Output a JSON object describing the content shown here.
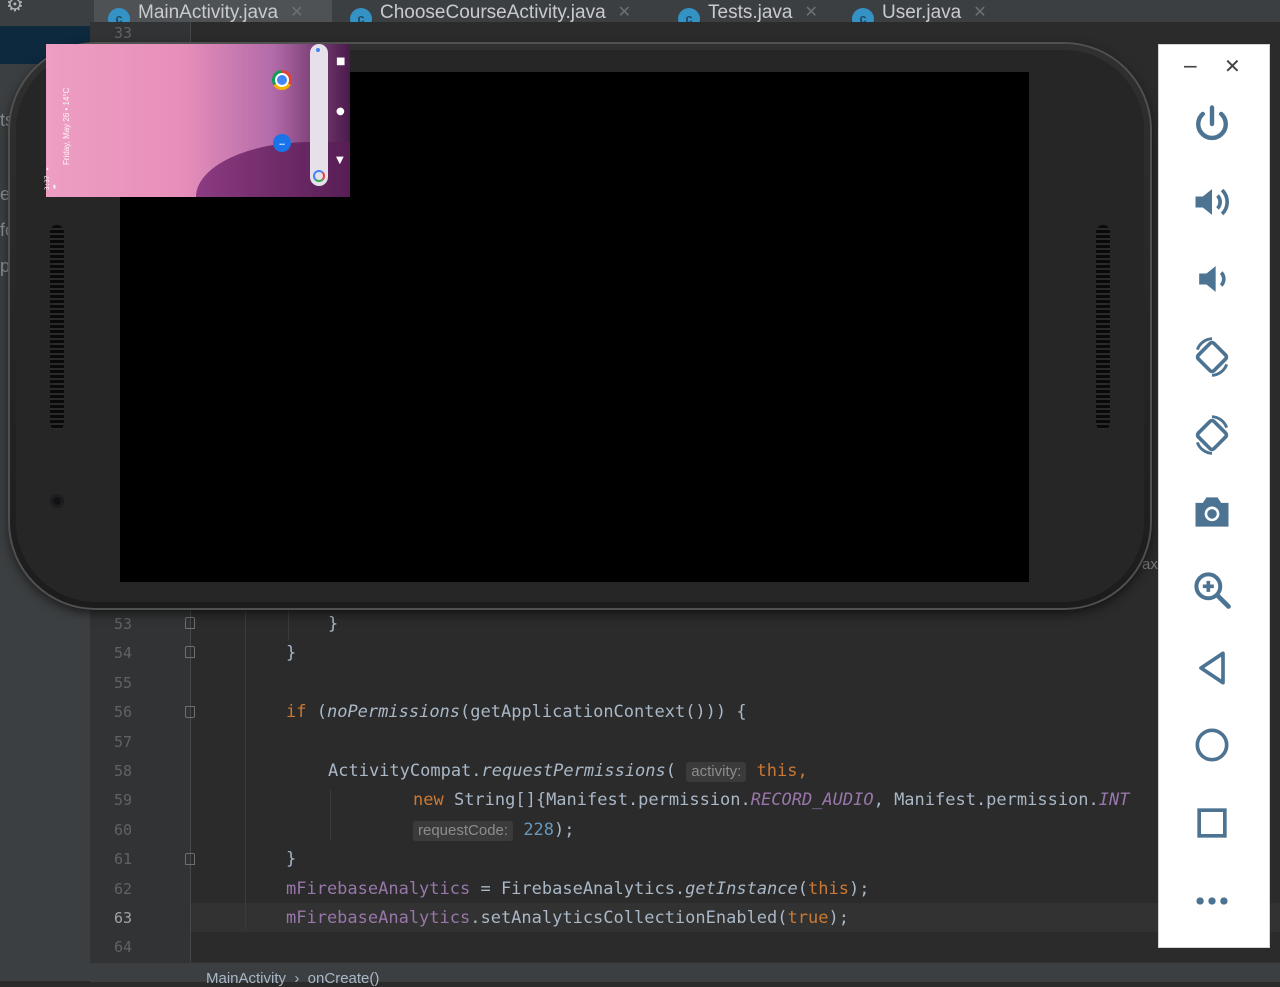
{
  "ide": {
    "tabs": [
      {
        "label": "MainActivity.java",
        "icon": "c"
      },
      {
        "label": "ChooseCourseActivity.java",
        "icon": "c"
      },
      {
        "label": "Tests.java",
        "icon": "c"
      },
      {
        "label": "User.java",
        "icon": "c"
      }
    ],
    "tab_close": "✕",
    "left_fragments": [
      "ts",
      "er",
      "fo",
      "p"
    ],
    "top_line_number": "33",
    "fragment_right": "ax",
    "gutter": {
      "lines": [
        {
          "n": "53"
        },
        {
          "n": "54"
        },
        {
          "n": "55"
        },
        {
          "n": "56"
        },
        {
          "n": "57"
        },
        {
          "n": "58"
        },
        {
          "n": "59"
        },
        {
          "n": "60"
        },
        {
          "n": "61"
        },
        {
          "n": "62"
        },
        {
          "n": "63"
        },
        {
          "n": "64"
        }
      ]
    },
    "code": {
      "l53": "}",
      "l54": "}",
      "l56_kw": "if",
      "l56_open": " (",
      "l56_call": "noPermissions",
      "l56_rest": "(getApplicationContext())) {",
      "l58_cls": "ActivityCompat.",
      "l58_call": "requestPermissions",
      "l58_paren": "(",
      "l58_hint": "activity:",
      "l58_this": "this",
      "l58_comma": ",",
      "l59_new": "new",
      "l59_type": " String[]{Manifest.permission.",
      "l59_const": "RECORD_AUDIO",
      "l59_mid": ", Manifest.permission.",
      "l59_const2": "INT",
      "l60_hint": "requestCode:",
      "l60_num": "228",
      "l60_end": ");",
      "l61": "}",
      "l62_field": "mFirebaseAnalytics",
      "l62_mid": " = FirebaseAnalytics.",
      "l62_call": "getInstance",
      "l62_open": "(",
      "l62_this": "this",
      "l62_end": ");",
      "l63_field": "mFirebaseAnalytics",
      "l63_mid": ".setAnalyticsCollectionEnabled(",
      "l63_true": "true",
      "l63_end": ");"
    },
    "breadcrumb": "MainActivity  ›  onCreate()"
  },
  "emulator": {
    "thumbnail": {
      "date_text": "Friday, May 26  •  14°C",
      "status_text": "3:37 ▾ ▮",
      "messages_icon": "…",
      "nav_home": "●",
      "nav_recent": "■",
      "nav_back": "▼"
    }
  },
  "toolbar": {
    "minimize": "−",
    "close": "✕",
    "buttons": [
      {
        "name": "power",
        "icon": "power-icon"
      },
      {
        "name": "volume-up",
        "icon": "volume-up-icon"
      },
      {
        "name": "volume-down",
        "icon": "volume-down-icon"
      },
      {
        "name": "rotate-left",
        "icon": "rotate-left-icon"
      },
      {
        "name": "rotate-right",
        "icon": "rotate-right-icon"
      },
      {
        "name": "screenshot",
        "icon": "camera-icon"
      },
      {
        "name": "zoom",
        "icon": "zoom-in-icon"
      },
      {
        "name": "back",
        "icon": "back-triangle-icon"
      },
      {
        "name": "home",
        "icon": "home-circle-icon"
      },
      {
        "name": "overview",
        "icon": "overview-square-icon"
      },
      {
        "name": "more",
        "icon": "more-dots-icon"
      }
    ],
    "icon_color": "#4d7392"
  }
}
